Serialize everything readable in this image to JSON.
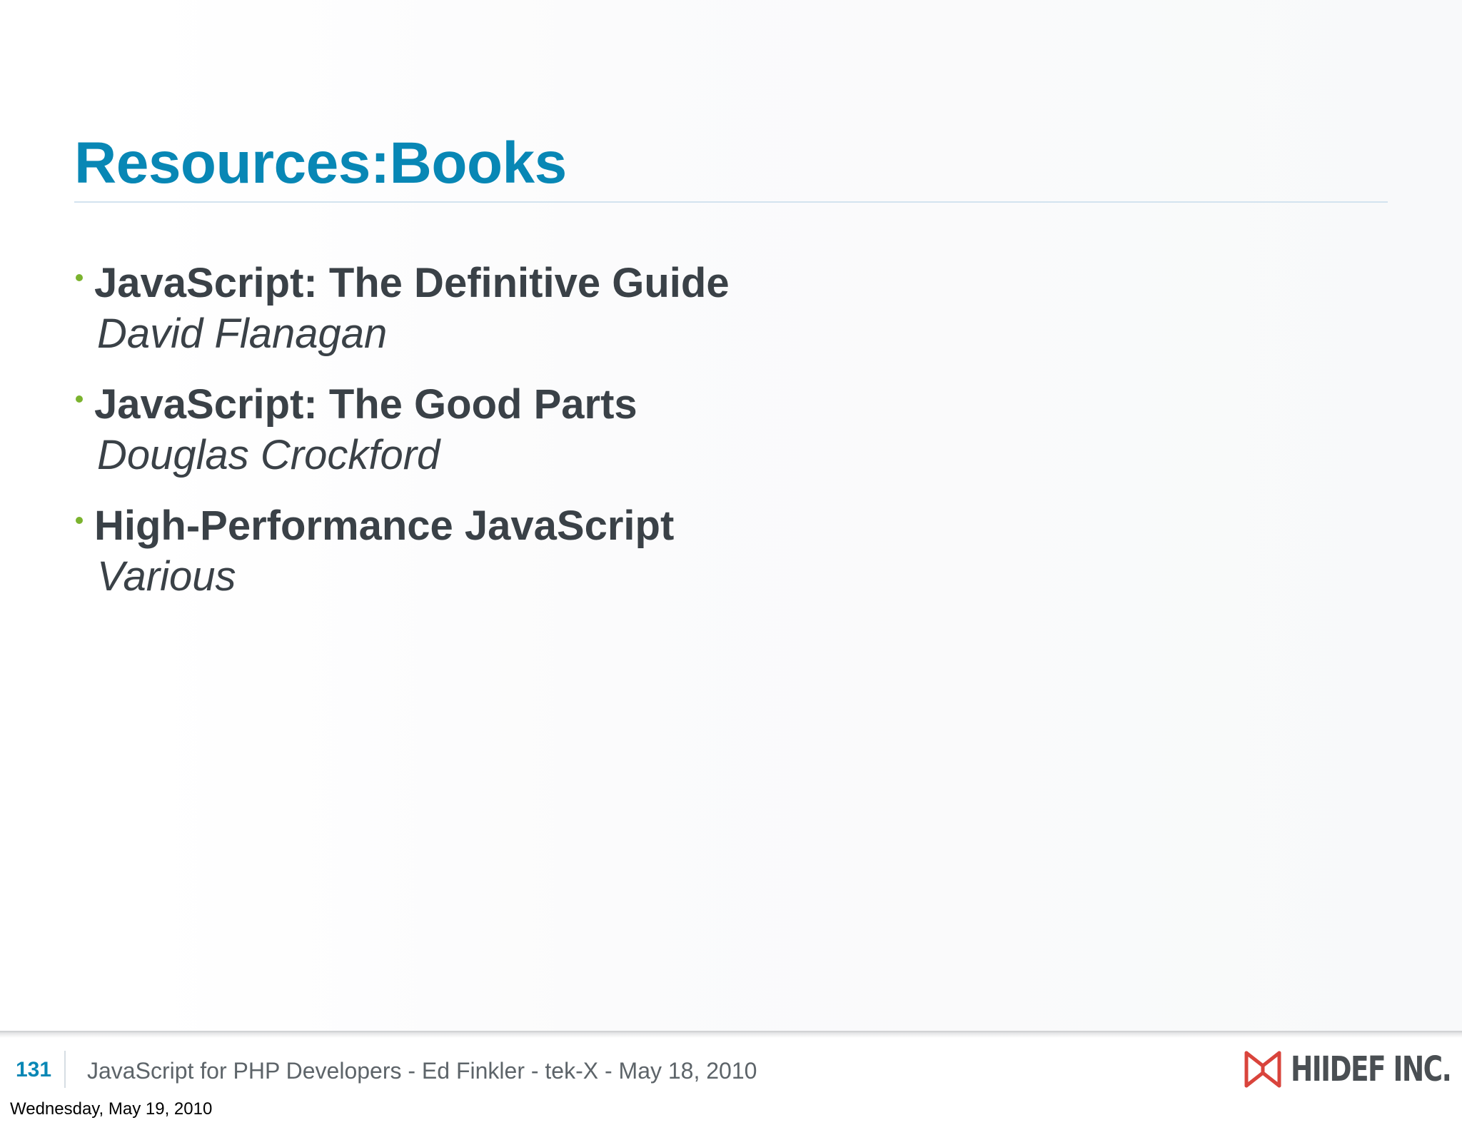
{
  "slide": {
    "title": "Resources:Books",
    "books": [
      {
        "title": "JavaScript: The Definitive Guide",
        "author": "David Flanagan"
      },
      {
        "title": "JavaScript: The Good Parts",
        "author": "Douglas Crockford"
      },
      {
        "title": "High-Performance JavaScript",
        "author": "Various"
      }
    ]
  },
  "footer": {
    "page_number": "131",
    "text": "JavaScript for PHP Developers - Ed Finkler - tek-X - May 18, 2010",
    "logo_text": "HIIDEF INC."
  },
  "print_date": "Wednesday, May 19, 2010",
  "colors": {
    "title": "#0887b5",
    "bullet": "#7bb32e",
    "body_text": "#3a4147",
    "logo_mark": "#d9443c"
  },
  "icons": {
    "bullet": "bullet-dot-icon",
    "logo": "hiidef-logo-mark-icon"
  }
}
